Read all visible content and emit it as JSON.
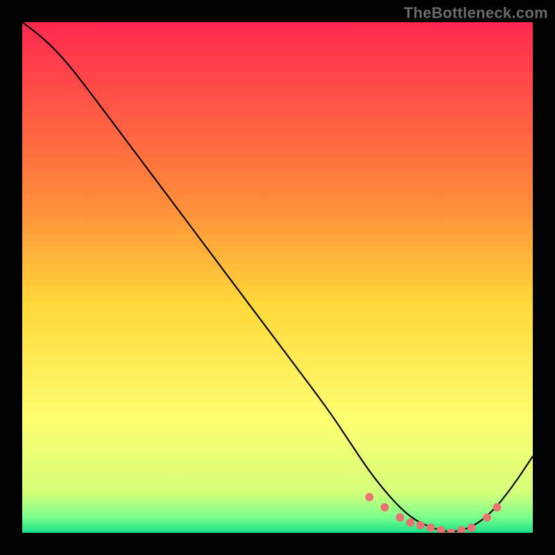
{
  "watermark": "TheBottleneck.com",
  "colors": {
    "gradient_top": "#ff2850",
    "gradient_mid_upper": "#ff8a3a",
    "gradient_mid": "#ffd83a",
    "gradient_mid_lower": "#feff71",
    "gradient_bottom": "#18e08a",
    "curve": "#000000",
    "markers": "#e97272",
    "frame": "#000000"
  },
  "chart_data": {
    "type": "line",
    "title": "",
    "xlabel": "",
    "ylabel": "",
    "xlim": [
      0,
      100
    ],
    "ylim": [
      0,
      100
    ],
    "grid": false,
    "legend": null,
    "series": [
      {
        "name": "bottleneck-curve",
        "x": [
          0,
          4,
          8,
          12,
          18,
          24,
          30,
          36,
          42,
          48,
          54,
          60,
          64,
          68,
          72,
          76,
          80,
          84,
          88,
          92,
          96,
          100
        ],
        "y": [
          100,
          97,
          93,
          88,
          80,
          72,
          64,
          56,
          48,
          40,
          32,
          24,
          18,
          12,
          7,
          3,
          1,
          0,
          1,
          4,
          9,
          15
        ]
      }
    ],
    "markers": {
      "name": "highlight-points",
      "points": [
        {
          "x": 68,
          "y": 7
        },
        {
          "x": 71,
          "y": 5
        },
        {
          "x": 74,
          "y": 3
        },
        {
          "x": 76,
          "y": 2
        },
        {
          "x": 78,
          "y": 1.5
        },
        {
          "x": 80,
          "y": 1
        },
        {
          "x": 82,
          "y": 0.5
        },
        {
          "x": 84,
          "y": 0
        },
        {
          "x": 86,
          "y": 0.5
        },
        {
          "x": 88,
          "y": 1
        },
        {
          "x": 91,
          "y": 3
        },
        {
          "x": 93,
          "y": 5
        }
      ]
    },
    "gradient_stops": [
      {
        "offset": 0.0,
        "color": "#ff2850"
      },
      {
        "offset": 0.35,
        "color": "#ff8a3a"
      },
      {
        "offset": 0.55,
        "color": "#ffd83a"
      },
      {
        "offset": 0.78,
        "color": "#feff71"
      },
      {
        "offset": 0.92,
        "color": "#d6ff7a"
      },
      {
        "offset": 0.97,
        "color": "#7aff8c"
      },
      {
        "offset": 1.0,
        "color": "#18e08a"
      }
    ]
  }
}
